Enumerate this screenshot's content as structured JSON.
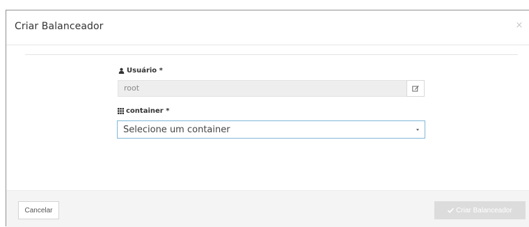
{
  "modal": {
    "title": "Criar Balanceador",
    "close_glyph": "×"
  },
  "form": {
    "user": {
      "label": "Usuário *",
      "icon": "user-icon",
      "value": "root",
      "addon_icon": "edit-icon"
    },
    "container": {
      "label": "container *",
      "icon": "grid-icon",
      "selected": "Selecione um container"
    }
  },
  "footer": {
    "cancel_label": "Cancelar",
    "submit_label": "Criar Balanceador",
    "submit_icon": "check-icon"
  },
  "colors": {
    "select_border": "#7fb8d8",
    "submit_disabled_bg": "#dcdcdc",
    "footer_bg": "#f4f4f4"
  }
}
